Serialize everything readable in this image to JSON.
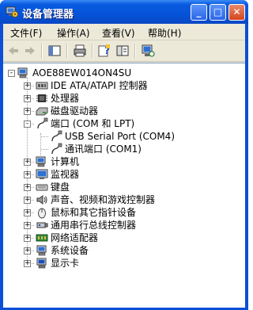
{
  "window": {
    "title": "设备管理器",
    "controls": {
      "minimize": "_",
      "maximize": "□",
      "close": "✕"
    }
  },
  "menu": [
    {
      "label": "文件(F)"
    },
    {
      "label": "操作(A)"
    },
    {
      "label": "查看(V)"
    },
    {
      "label": "帮助(H)"
    }
  ],
  "toolbar": {
    "buttons": [
      "back-icon",
      "forward-icon",
      "console-tree-icon",
      "print-icon",
      "properties-help-icon",
      "show-hide-icon",
      "scan-hardware-icon"
    ]
  },
  "tree": {
    "root": {
      "label": "AOE88EW014ON4SU",
      "icon": "computer-icon"
    },
    "items": [
      {
        "label": "IDE ATA/ATAPI 控制器",
        "icon": "ide-controller-icon",
        "expander": "+"
      },
      {
        "label": "处理器",
        "icon": "processor-icon",
        "expander": "+"
      },
      {
        "label": "磁盘驱动器",
        "icon": "disk-drive-icon",
        "expander": "+"
      },
      {
        "label": "端口 (COM 和 LPT)",
        "icon": "port-icon",
        "expander": "-",
        "children": [
          {
            "label": "USB Serial Port (COM4)",
            "icon": "port-icon"
          },
          {
            "label": "通讯端口 (COM1)",
            "icon": "port-icon"
          }
        ]
      },
      {
        "label": "计算机",
        "icon": "computer-icon",
        "expander": "+"
      },
      {
        "label": "监视器",
        "icon": "monitor-icon",
        "expander": "+"
      },
      {
        "label": "键盘",
        "icon": "keyboard-icon",
        "expander": "+"
      },
      {
        "label": "声音、视频和游戏控制器",
        "icon": "sound-icon",
        "expander": "+"
      },
      {
        "label": "鼠标和其它指针设备",
        "icon": "mouse-icon",
        "expander": "+"
      },
      {
        "label": "通用串行总线控制器",
        "icon": "usb-icon",
        "expander": "+"
      },
      {
        "label": "网络适配器",
        "icon": "network-adapter-icon",
        "expander": "+"
      },
      {
        "label": "系统设备",
        "icon": "system-device-icon",
        "expander": "+"
      },
      {
        "label": "显示卡",
        "icon": "display-adapter-icon",
        "expander": "+"
      }
    ]
  }
}
